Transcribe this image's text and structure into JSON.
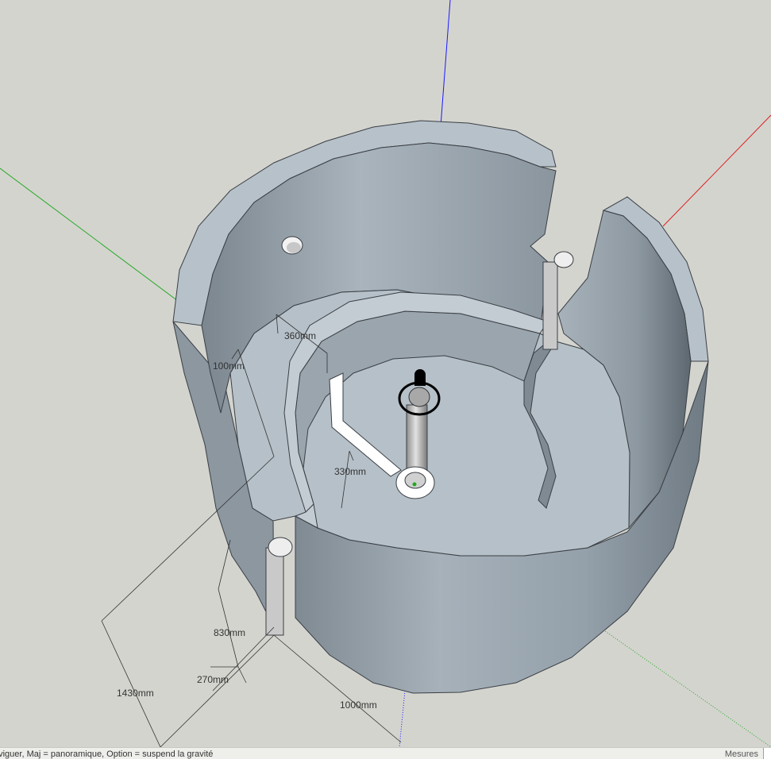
{
  "viewport": {
    "background_color": "#d4d4cf",
    "model_color": "#9aa5ae",
    "axes": {
      "blue_color": "#1a1aff",
      "red_color": "#dd2222",
      "green_color": "#22aa22"
    },
    "dimensions": {
      "d360": "360mm",
      "d100": "100mm",
      "d330": "330mm",
      "d830": "830mm",
      "d270": "270mm",
      "d1430": "1430mm",
      "d1000": "1000mm"
    },
    "icons": [
      "orbit-cursor-icon",
      "axis-origin-icon"
    ]
  },
  "status_bar": {
    "hint": "aviguer, Maj = panoramique, Option = suspend la gravité",
    "measure_label": "Mesures"
  }
}
